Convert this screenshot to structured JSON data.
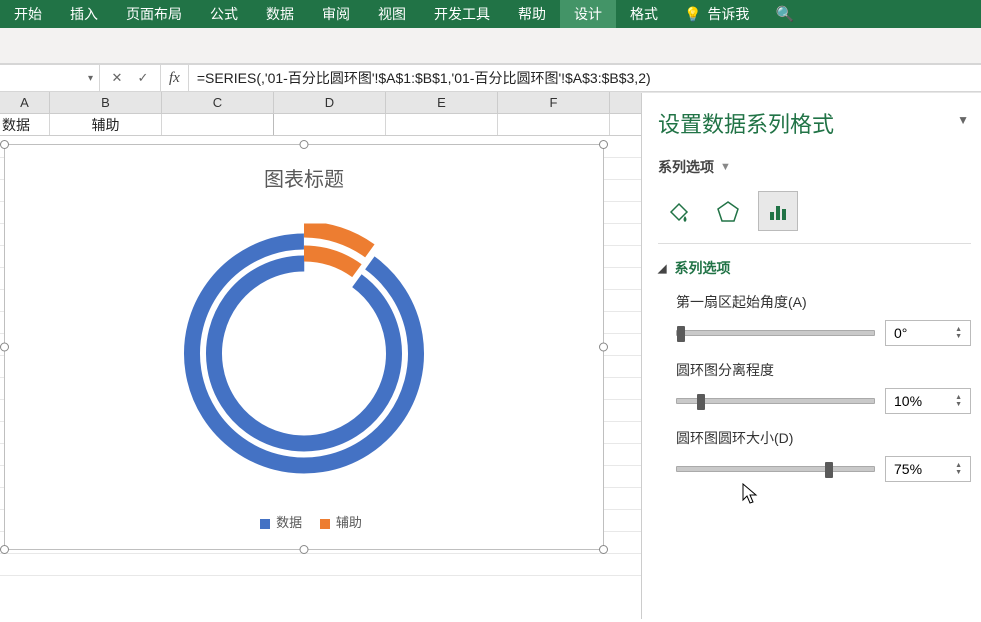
{
  "ribbon": {
    "tabs": [
      "开始",
      "插入",
      "页面布局",
      "公式",
      "数据",
      "审阅",
      "视图",
      "开发工具",
      "帮助",
      "设计",
      "格式"
    ],
    "tell_me": "告诉我",
    "active_index": 9
  },
  "formula_bar": {
    "name_box": "",
    "cancel_glyph": "✕",
    "accept_glyph": "✓",
    "fx_glyph": "fx",
    "formula": "=SERIES(,'01-百分比圆环图'!$A$1:$B$1,'01-百分比圆环图'!$A$3:$B$3,2)"
  },
  "grid": {
    "columns": [
      "A",
      "B",
      "C",
      "D",
      "E",
      "F"
    ],
    "row1": {
      "A": "数据",
      "B": "辅助"
    }
  },
  "chart": {
    "title": "图表标题",
    "legend": {
      "series1": "数据",
      "series2": "辅助"
    }
  },
  "chart_data": {
    "type": "pie",
    "note": "Double doughnut; each ring has two slices (数据=orange, 辅助=blue). Explosion approx 10% on the orange slice. Start angle 0°. Hole size 75%.",
    "rings": [
      {
        "name": "outer",
        "slices": [
          {
            "name": "数据",
            "value": 10
          },
          {
            "name": "辅助",
            "value": 90
          }
        ]
      },
      {
        "name": "inner",
        "slices": [
          {
            "name": "数据",
            "value": 10
          },
          {
            "name": "辅助",
            "value": 90
          }
        ]
      }
    ],
    "colors": {
      "数据": "#ed7d31",
      "辅助": "#4472c4"
    },
    "title": "图表标题",
    "legend": [
      "数据",
      "辅助"
    ]
  },
  "side_panel": {
    "title": "设置数据系列格式",
    "dropdown_label": "系列选项",
    "section_label": "系列选项",
    "fields": {
      "angle": {
        "label": "第一扇区起始角度(A)",
        "value": "0°",
        "slider_pos_pct": 0
      },
      "explosion": {
        "label": "圆环图分离程度",
        "value": "10%",
        "slider_pos_pct": 10
      },
      "hole": {
        "label": "圆环图圆环大小(D)",
        "value": "75%",
        "slider_pos_pct": 75
      }
    }
  }
}
